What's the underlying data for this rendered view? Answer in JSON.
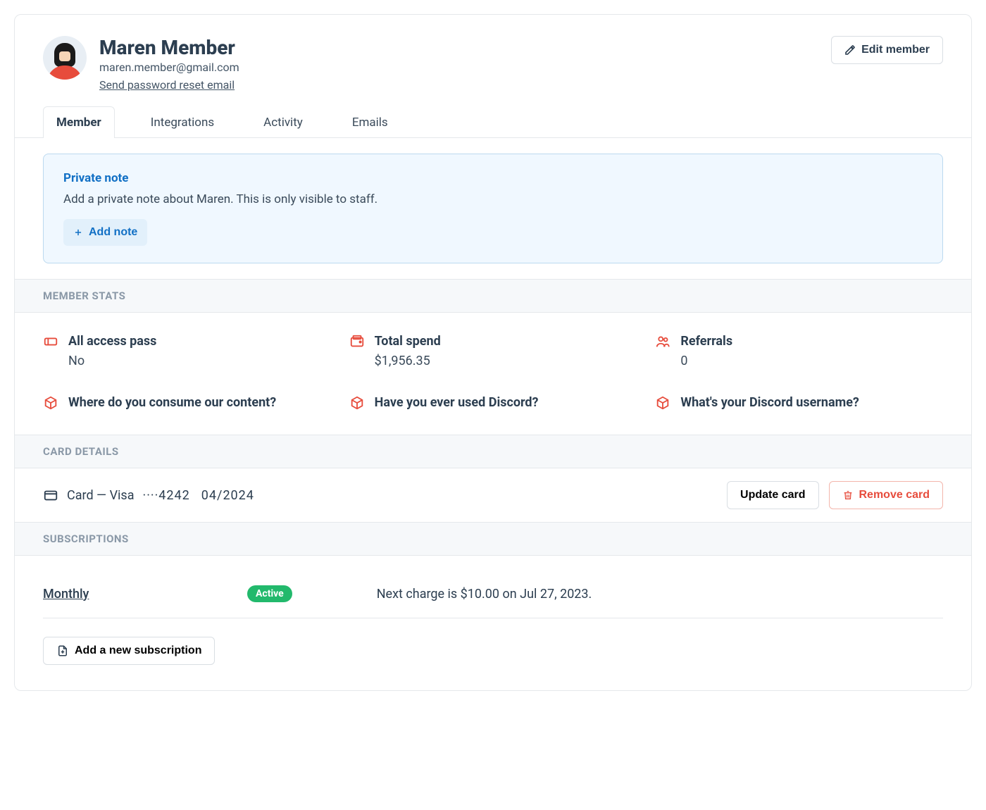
{
  "header": {
    "name": "Maren Member",
    "email": "maren.member@gmail.com",
    "reset_link": "Send password reset email",
    "edit_button": "Edit member"
  },
  "tabs": [
    {
      "label": "Member",
      "active": true
    },
    {
      "label": "Integrations",
      "active": false
    },
    {
      "label": "Activity",
      "active": false
    },
    {
      "label": "Emails",
      "active": false
    }
  ],
  "note": {
    "title": "Private note",
    "description": "Add a private note about Maren. This is only visible to staff.",
    "button": "Add note"
  },
  "sections": {
    "stats": "MEMBER STATS",
    "card": "CARD DETAILS",
    "subs": "SUBSCRIPTIONS"
  },
  "stats": [
    {
      "icon": "ticket",
      "label": "All access pass",
      "value": "No"
    },
    {
      "icon": "wallet",
      "label": "Total spend",
      "value": "$1,956.35"
    },
    {
      "icon": "users",
      "label": "Referrals",
      "value": "0"
    },
    {
      "icon": "box",
      "label": "Where do you consume our content?",
      "value": ""
    },
    {
      "icon": "box",
      "label": "Have you ever used Discord?",
      "value": ""
    },
    {
      "icon": "box",
      "label": "What's your Discord username?",
      "value": ""
    }
  ],
  "card_details": {
    "text": "Card — Visa",
    "last4": "····4242",
    "expiry": "04/2024",
    "update_button": "Update card",
    "remove_button": "Remove card"
  },
  "subscription": {
    "name": "Monthly",
    "status": "Active",
    "next_charge": "Next charge is $10.00 on  Jul 27, 2023.",
    "add_button": "Add a new subscription"
  },
  "colors": {
    "accent_blue": "#1270c5",
    "accent_red": "#e74c3c",
    "badge_green": "#22b96c"
  }
}
